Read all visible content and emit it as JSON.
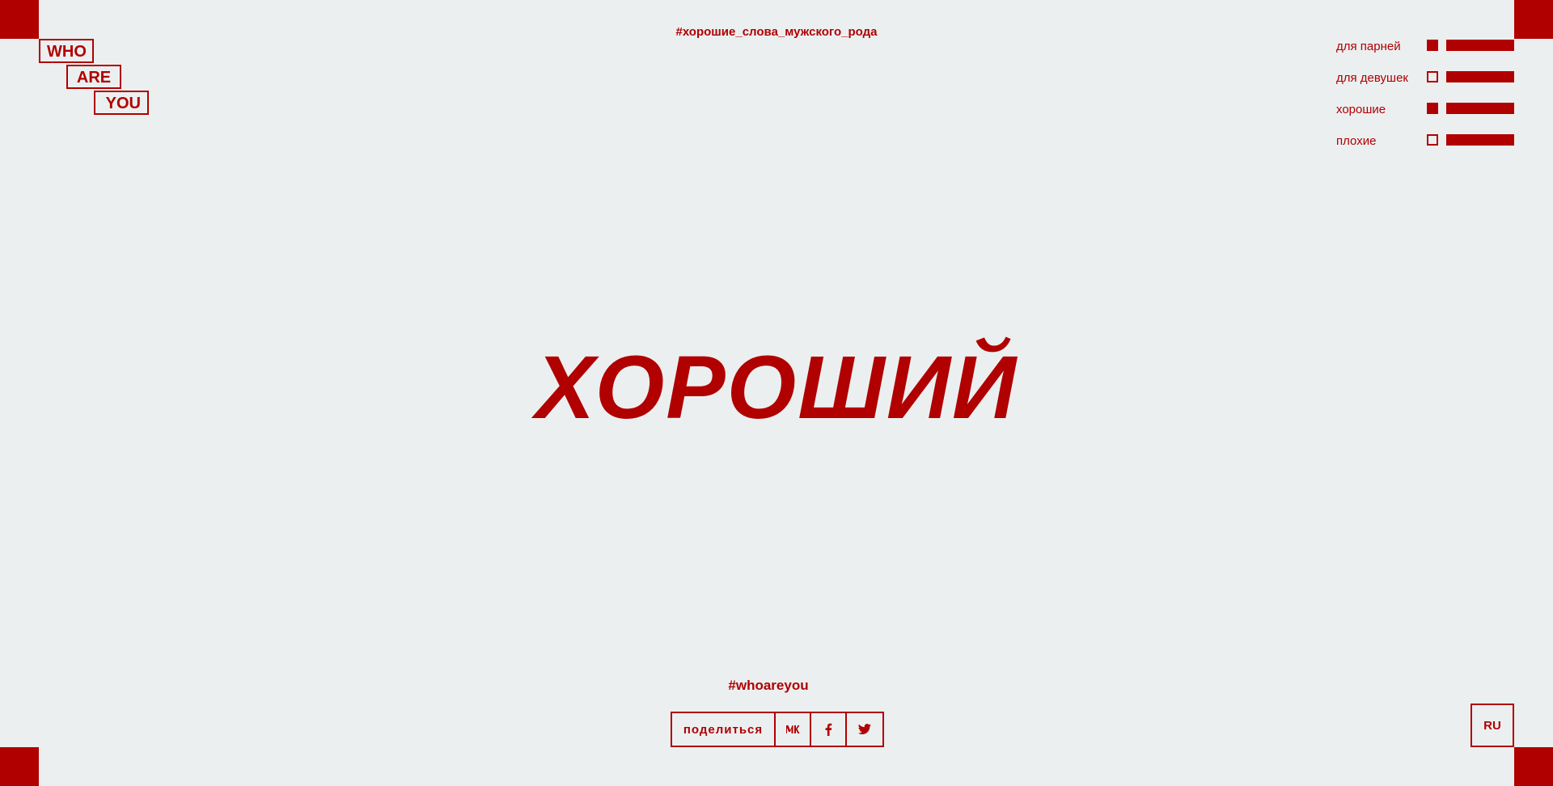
{
  "logo": {
    "words": [
      "WHO",
      "ARE",
      "YOU"
    ]
  },
  "top_hashtag": "#хорошие_слова_мужского_рода",
  "filters": [
    {
      "label": "для парней",
      "checked": true
    },
    {
      "label": "для девушек",
      "checked": false
    },
    {
      "label": "хорошие",
      "checked": true
    },
    {
      "label": "плохие",
      "checked": false
    }
  ],
  "main_word": "ХОРОШИЙ",
  "bottom_hashtag": "#whoareyou",
  "share": {
    "label": "поделиться",
    "icons": [
      "vk-icon",
      "facebook-icon",
      "twitter-icon"
    ]
  },
  "lang": "RU",
  "colors": {
    "accent": "#b00000",
    "background": "#eceff0"
  }
}
